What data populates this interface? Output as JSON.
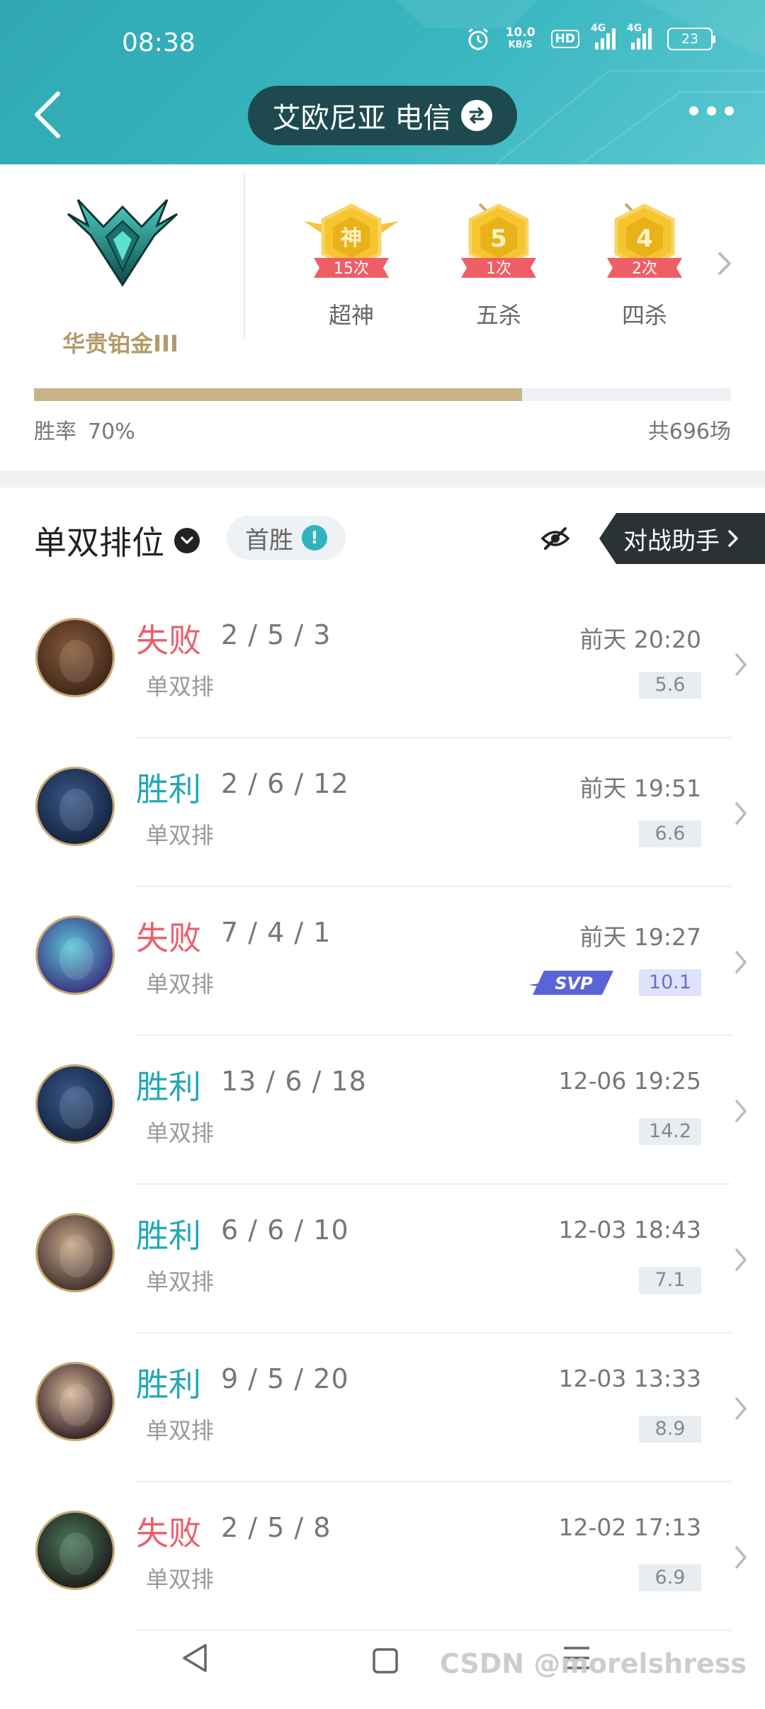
{
  "status_bar": {
    "time": "08:38",
    "net_speed_value": "10.0",
    "net_speed_unit": "KB/S",
    "hd_label": "HD",
    "signal1_label": "4G",
    "signal2_label": "4G",
    "battery": "23",
    "icons": [
      "alarm-icon",
      "hd-icon",
      "signal-icon",
      "signal-icon",
      "battery-icon"
    ]
  },
  "header": {
    "server_name": "艾欧尼亚 电信",
    "icons": [
      "back-arrow-icon",
      "swap-icon",
      "more-icon"
    ]
  },
  "profile": {
    "rank_name": "华贵铂金III",
    "achievements": [
      {
        "badge": "神",
        "count": "15次",
        "label": "超神"
      },
      {
        "badge": "5",
        "count": "1次",
        "label": "五杀"
      },
      {
        "badge": "4",
        "count": "2次",
        "label": "四杀"
      }
    ],
    "win_rate_label": "胜率",
    "win_rate_value": "70%",
    "win_rate_fraction": 0.7,
    "total_games": "共696场"
  },
  "filter": {
    "mode": "单双排位",
    "first_win_label": "首胜",
    "battle_helper_label": "对战助手"
  },
  "matches": [
    {
      "result": "失败",
      "outcome": "loss",
      "kda": "2 / 5 / 3",
      "queue": "单双排",
      "time": "前天 20:20",
      "score": "5.6",
      "svp": false,
      "avatar_colors": [
        "#8a5a3a",
        "#3a2418"
      ]
    },
    {
      "result": "胜利",
      "outcome": "win",
      "kda": "2 / 6 / 12",
      "queue": "单双排",
      "time": "前天 19:51",
      "score": "6.6",
      "svp": false,
      "avatar_colors": [
        "#3a5a8c",
        "#12203a"
      ]
    },
    {
      "result": "失败",
      "outcome": "loss",
      "kda": "7 / 4 / 1",
      "queue": "单双排",
      "time": "前天 19:27",
      "score": "10.1",
      "svp": true,
      "svp_label": "SVP",
      "avatar_colors": [
        "#5ac8d8",
        "#3a2a7a"
      ]
    },
    {
      "result": "胜利",
      "outcome": "win",
      "kda": "13 / 6 / 18",
      "queue": "单双排",
      "time": "12-06 19:25",
      "score": "14.2",
      "svp": false,
      "avatar_colors": [
        "#3a5a8c",
        "#12203a"
      ]
    },
    {
      "result": "胜利",
      "outcome": "win",
      "kda": "6 / 6 / 10",
      "queue": "单双排",
      "time": "12-03 18:43",
      "score": "7.1",
      "svp": false,
      "avatar_colors": [
        "#c8a888",
        "#3a2a2a"
      ]
    },
    {
      "result": "胜利",
      "outcome": "win",
      "kda": "9 / 5 / 20",
      "queue": "单双排",
      "time": "12-03 13:33",
      "score": "8.9",
      "svp": false,
      "avatar_colors": [
        "#d8b898",
        "#2a1a22"
      ]
    },
    {
      "result": "失败",
      "outcome": "loss",
      "kda": "2 / 5 / 8",
      "queue": "单双排",
      "time": "12-02 17:13",
      "score": "6.9",
      "svp": false,
      "avatar_colors": [
        "#4a7a5a",
        "#1a1a1a"
      ]
    }
  ],
  "watermark": "CSDN @morelshress",
  "colors": {
    "accent": "#2fb4bf",
    "win": "#23a9b6",
    "loss": "#e8606b",
    "rank_gold": "#b49a6a",
    "progress": "#c8b387"
  }
}
